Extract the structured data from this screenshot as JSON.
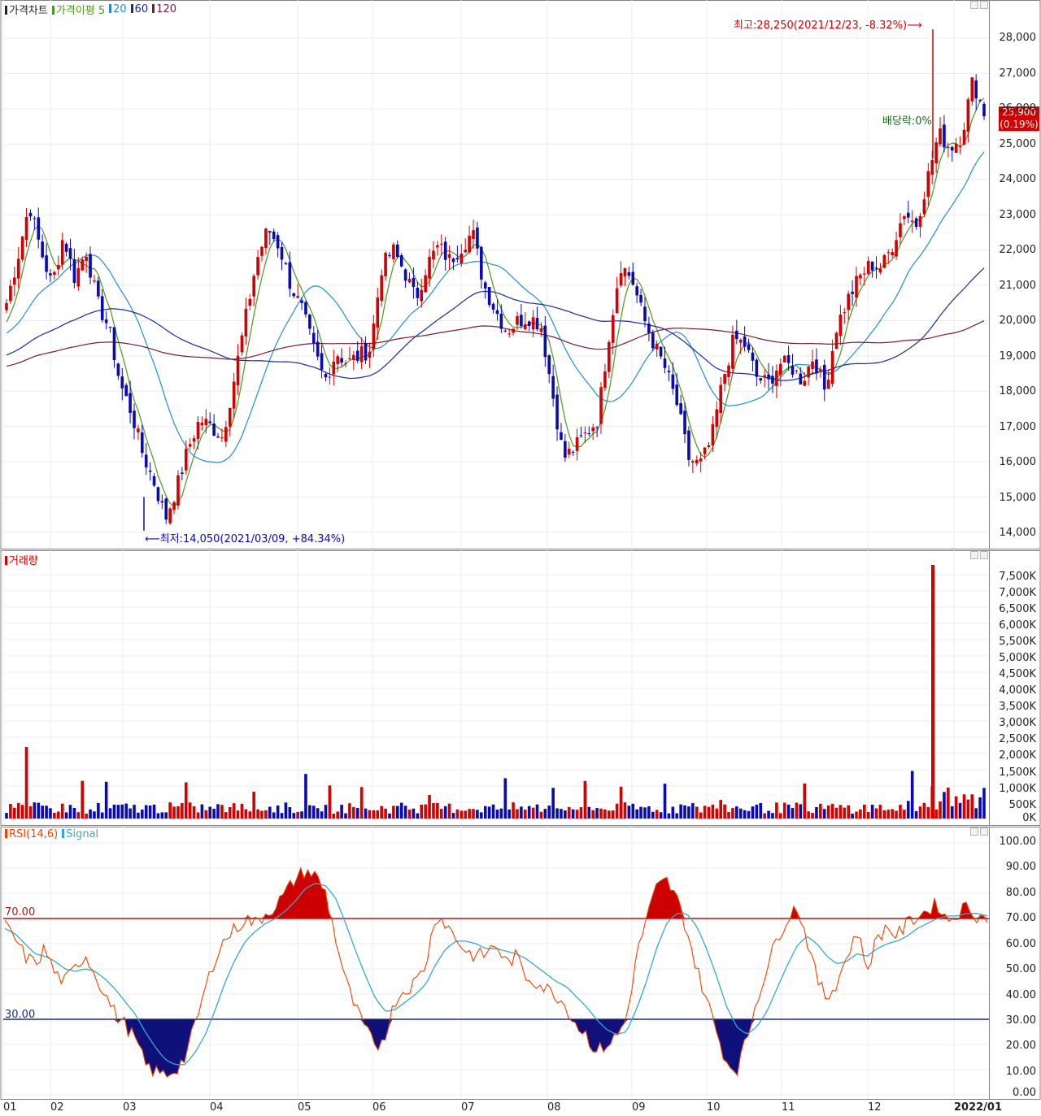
{
  "price_panel": {
    "legend": {
      "title": "가격차트",
      "ma_label": "가격이평",
      "ma_periods": [
        "5",
        "20",
        "60",
        "120"
      ]
    },
    "high_note": "최고:28,250(2021/12/23, -8.32%)",
    "low_note": "최저:14,050(2021/03/09, +84.34%)",
    "dividend_note": "배당락:0%",
    "last_price": "25,900",
    "last_change": "(0.19%)",
    "y_ticks": [
      "28,000",
      "27,000",
      "26,000",
      "25,000",
      "24,000",
      "23,000",
      "22,000",
      "21,000",
      "20,000",
      "19,000",
      "18,000",
      "17,000",
      "16,000",
      "15,000",
      "14,000"
    ]
  },
  "volume_panel": {
    "legend": "거래량",
    "y_ticks": [
      "7,500K",
      "7,000K",
      "6,500K",
      "6,000K",
      "5,500K",
      "5,000K",
      "4,500K",
      "4,000K",
      "3,500K",
      "3,000K",
      "2,500K",
      "2,000K",
      "1,500K",
      "1,000K",
      "500K",
      "0K"
    ]
  },
  "rsi_panel": {
    "legend": {
      "rsi": "RSI(14,6)",
      "signal": "Signal"
    },
    "upper_label": "70.00",
    "lower_label": "30.00",
    "y_ticks": [
      "100.00",
      "90.00",
      "80.00",
      "70.00",
      "60.00",
      "50.00",
      "40.00",
      "30.00",
      "20.00",
      "10.00",
      "0.00"
    ]
  },
  "x_ticks": [
    "01",
    "02",
    "03",
    "04",
    "05",
    "06",
    "07",
    "08",
    "09",
    "10",
    "11",
    "12",
    "2022/01"
  ],
  "colors": {
    "up": "#d40000",
    "down": "#0a0ab4",
    "ma5": "#4a9a1a",
    "ma20": "#1e90d0",
    "ma60": "#1a2aa0",
    "ma120": "#7a1a3a",
    "rsi": "#ee4400",
    "signal": "#33aacc"
  },
  "chart_data": {
    "type": "candlestick",
    "period": "2021/01 - 2022/01",
    "x": [
      "2021-01",
      "2021-02",
      "2021-03",
      "2021-04",
      "2021-05",
      "2021-06",
      "2021-07",
      "2021-08",
      "2021-09",
      "2021-10",
      "2021-11",
      "2021-12",
      "2022-01"
    ],
    "price": {
      "close_path": [
        20500,
        21800,
        23300,
        22000,
        21000,
        22400,
        21200,
        22000,
        20500,
        19800,
        18200,
        17400,
        16200,
        15400,
        14400,
        15300,
        16400,
        17200,
        17000,
        16700,
        18300,
        20000,
        21700,
        22600,
        22100,
        21000,
        20300,
        19200,
        18300,
        19100,
        18800,
        19000,
        19200,
        21500,
        22000,
        21400,
        20600,
        21600,
        22100,
        21700,
        22100,
        22500,
        21000,
        20300,
        19700,
        20000,
        20100,
        19900,
        18000,
        16100,
        16400,
        16800,
        17200,
        19600,
        21600,
        21200,
        20100,
        19300,
        18600,
        17600,
        16100,
        15900,
        16600,
        18300,
        19500,
        19300,
        18400,
        18200,
        18800,
        18700,
        18300,
        19000,
        18000,
        19800,
        20600,
        21200,
        21600,
        21500,
        22200,
        23100,
        22700,
        24000,
        25300,
        24900,
        25200,
        26800,
        25900
      ],
      "high": 28250,
      "high_date": "2021/12/23",
      "low": 14050,
      "low_date": "2021/03/09",
      "last": 25900,
      "ylim": [
        14000,
        28000
      ]
    },
    "volume": {
      "spike_k": 7800,
      "spike_date": "2021/12/23",
      "early_peak_k": 2200,
      "ylim_k": [
        0,
        7500
      ]
    },
    "rsi": {
      "rsi_path": [
        67,
        62,
        55,
        52,
        58,
        48,
        45,
        50,
        56,
        48,
        40,
        32,
        28,
        22,
        12,
        9,
        8,
        10,
        15,
        28,
        42,
        55,
        62,
        66,
        70,
        68,
        72,
        75,
        80,
        86,
        89,
        87,
        80,
        62,
        45,
        34,
        26,
        18,
        25,
        38,
        42,
        45,
        52,
        72,
        68,
        62,
        57,
        55,
        56,
        60,
        52,
        55,
        47,
        45,
        42,
        40,
        35,
        28,
        24,
        17,
        20,
        23,
        30,
        55,
        70,
        82,
        85,
        78,
        66,
        50,
        38,
        25,
        13,
        10,
        22,
        38,
        50,
        62,
        70,
        75,
        62,
        46,
        38,
        45,
        55,
        65,
        50,
        62,
        67,
        63,
        68,
        71,
        73,
        76,
        69,
        72,
        75,
        71,
        70
      ],
      "signal_path": [
        66,
        64,
        60,
        56,
        55,
        53,
        50,
        49,
        50,
        49,
        46,
        42,
        37,
        32,
        25,
        19,
        14,
        12,
        12,
        17,
        24,
        34,
        45,
        54,
        61,
        65,
        68,
        70,
        73,
        77,
        82,
        84,
        83,
        78,
        68,
        57,
        47,
        38,
        33,
        34,
        37,
        40,
        44,
        52,
        58,
        61,
        61,
        60,
        58,
        58,
        57,
        56,
        54,
        51,
        48,
        45,
        43,
        39,
        35,
        30,
        26,
        24,
        25,
        34,
        45,
        58,
        68,
        72,
        72,
        67,
        58,
        47,
        35,
        27,
        24,
        27,
        33,
        42,
        51,
        59,
        63,
        60,
        55,
        52,
        53,
        56,
        55,
        58,
        60,
        61,
        63,
        66,
        68,
        70,
        71,
        71,
        72,
        72,
        71
      ],
      "upper": 70,
      "lower": 30,
      "ylim": [
        0,
        100
      ]
    }
  }
}
